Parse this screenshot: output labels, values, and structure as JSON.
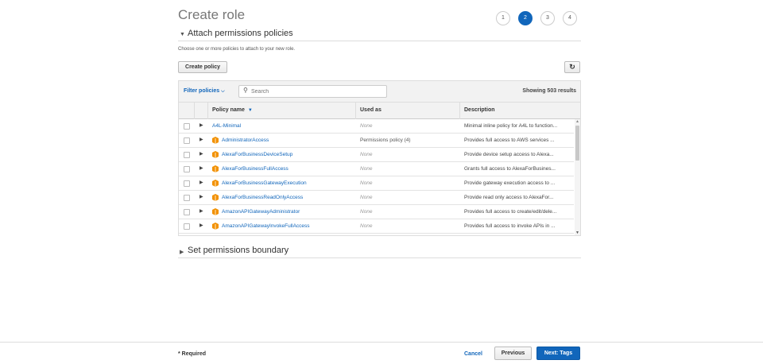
{
  "header": {
    "title": "Create role",
    "steps": [
      {
        "label": "1",
        "active": false
      },
      {
        "label": "2",
        "active": true
      },
      {
        "label": "3",
        "active": false
      },
      {
        "label": "4",
        "active": false
      }
    ]
  },
  "attach_section": {
    "title": "Attach permissions policies",
    "hint": "Choose one or more policies to attach to your new role.",
    "create_policy_label": "Create policy",
    "refresh_icon": "refresh-icon"
  },
  "table": {
    "filter_label": "Filter policies",
    "search_placeholder": "Search",
    "results_text": "Showing 503 results",
    "columns": {
      "policy_name": "Policy name",
      "used_as": "Used as",
      "description": "Description"
    },
    "rows": [
      {
        "name": "A4L-Minimal",
        "used_as": "None",
        "description": "Minimal inline policy for A4L to function...",
        "aws_managed": false
      },
      {
        "name": "AdministratorAccess",
        "used_as": "Permissions policy (4)",
        "description": "Provides full access to AWS services ...",
        "aws_managed": true
      },
      {
        "name": "AlexaForBusinessDeviceSetup",
        "used_as": "None",
        "description": "Provide device setup access to Alexa...",
        "aws_managed": true
      },
      {
        "name": "AlexaForBusinessFullAccess",
        "used_as": "None",
        "description": "Grants full access to AlexaForBusines...",
        "aws_managed": true
      },
      {
        "name": "AlexaForBusinessGatewayExecution",
        "used_as": "None",
        "description": "Provide gateway execution access to ...",
        "aws_managed": true
      },
      {
        "name": "AlexaForBusinessReadOnlyAccess",
        "used_as": "None",
        "description": "Provide read only access to AlexaFor...",
        "aws_managed": true
      },
      {
        "name": "AmazonAPIGatewayAdministrator",
        "used_as": "None",
        "description": "Provides full access to create/edit/dele...",
        "aws_managed": true
      },
      {
        "name": "AmazonAPIGatewayInvokeFullAccess",
        "used_as": "None",
        "description": "Provides full access to invoke APIs in ...",
        "aws_managed": true
      }
    ]
  },
  "boundary_section": {
    "title": "Set permissions boundary"
  },
  "footer": {
    "required_label": "* Required",
    "cancel_label": "Cancel",
    "previous_label": "Previous",
    "next_label": "Next: Tags"
  },
  "colors": {
    "accent": "#1166bb",
    "policy_icon": "#f29100"
  }
}
